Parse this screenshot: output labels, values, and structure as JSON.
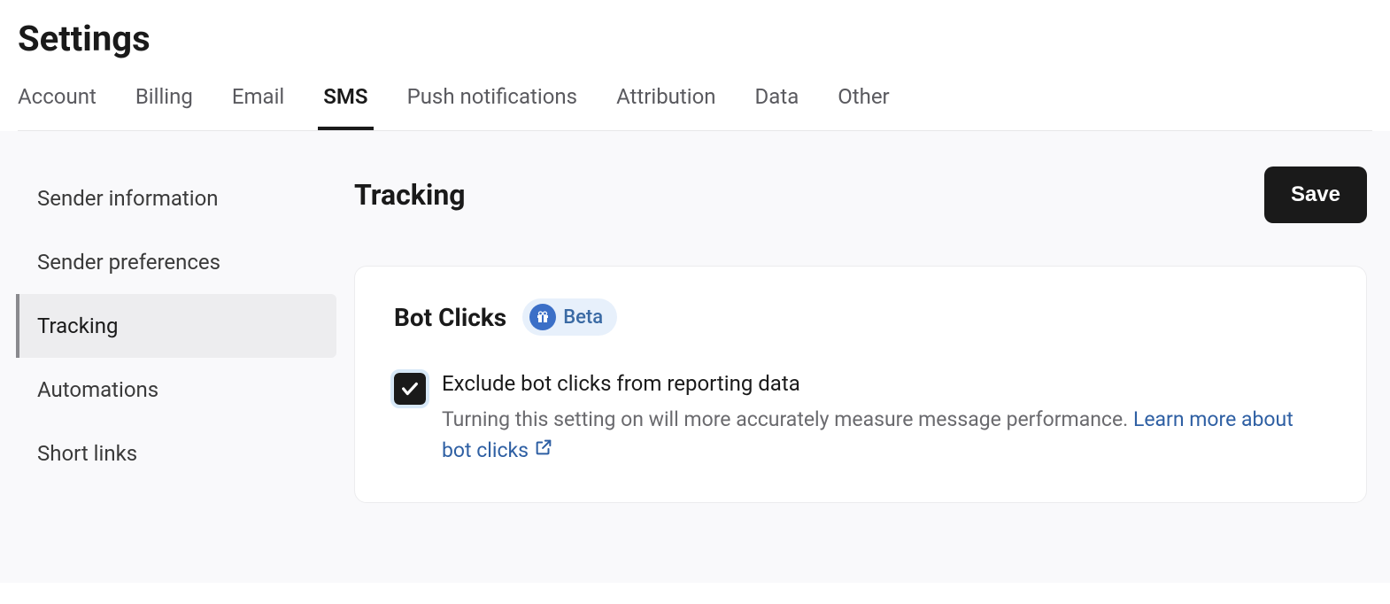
{
  "page": {
    "title": "Settings"
  },
  "tabs": [
    {
      "label": "Account",
      "active": false
    },
    {
      "label": "Billing",
      "active": false
    },
    {
      "label": "Email",
      "active": false
    },
    {
      "label": "SMS",
      "active": true
    },
    {
      "label": "Push notifications",
      "active": false
    },
    {
      "label": "Attribution",
      "active": false
    },
    {
      "label": "Data",
      "active": false
    },
    {
      "label": "Other",
      "active": false
    }
  ],
  "sidebar": {
    "items": [
      {
        "label": "Sender information",
        "active": false
      },
      {
        "label": "Sender preferences",
        "active": false
      },
      {
        "label": "Tracking",
        "active": true
      },
      {
        "label": "Automations",
        "active": false
      },
      {
        "label": "Short links",
        "active": false
      }
    ]
  },
  "main": {
    "section_title": "Tracking",
    "save_label": "Save",
    "card": {
      "title": "Bot Clicks",
      "badge": "Beta",
      "checkbox_checked": true,
      "setting_label": "Exclude bot clicks from reporting data",
      "setting_desc": "Turning this setting on will more accurately measure message performance. ",
      "learn_more": "Learn more about bot clicks"
    }
  }
}
